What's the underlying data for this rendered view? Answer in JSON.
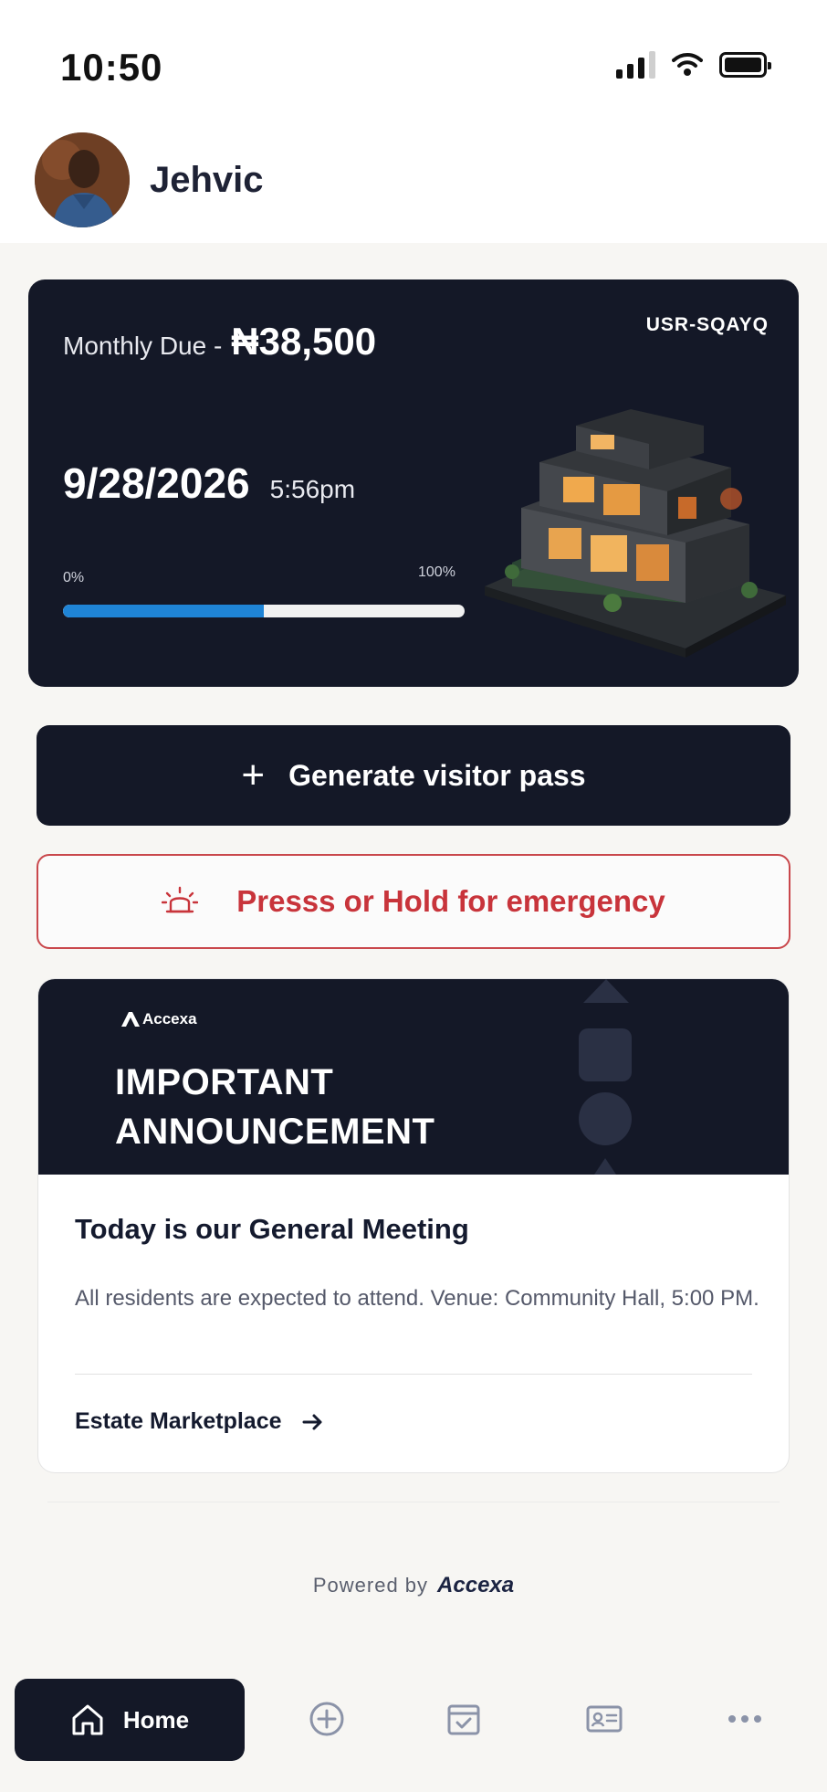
{
  "status_bar": {
    "time": "10:50"
  },
  "profile": {
    "name": "Jehvic"
  },
  "due_card": {
    "label": "Monthly Due -",
    "amount": "₦38,500",
    "user_code": "USR-SQAYQ",
    "date": "9/28/2026",
    "time": "5:56pm",
    "progress_start": "0%",
    "progress_end": "100%",
    "progress_fraction": 0.5
  },
  "actions": {
    "visitor_pass_label": "Generate visitor pass",
    "emergency_label": "Presss or Hold for emergency"
  },
  "announcement": {
    "brand": "Accexa",
    "title_line1": "IMPORTANT",
    "title_line2": "ANNOUNCEMENT",
    "heading": "Today is our General Meeting",
    "body": "All residents are expected to attend. Venue: Community Hall, 5:00 PM.",
    "link_label": "Estate Marketplace"
  },
  "footer": {
    "powered_by": "Powered by",
    "brand": "Accexa"
  },
  "bottom_nav": {
    "home_label": "Home",
    "items": [
      "home",
      "add",
      "calendar",
      "id-card",
      "more"
    ]
  },
  "colors": {
    "navy": "#141827",
    "progress": "#1f84d6",
    "emergency": "#c8343b"
  }
}
